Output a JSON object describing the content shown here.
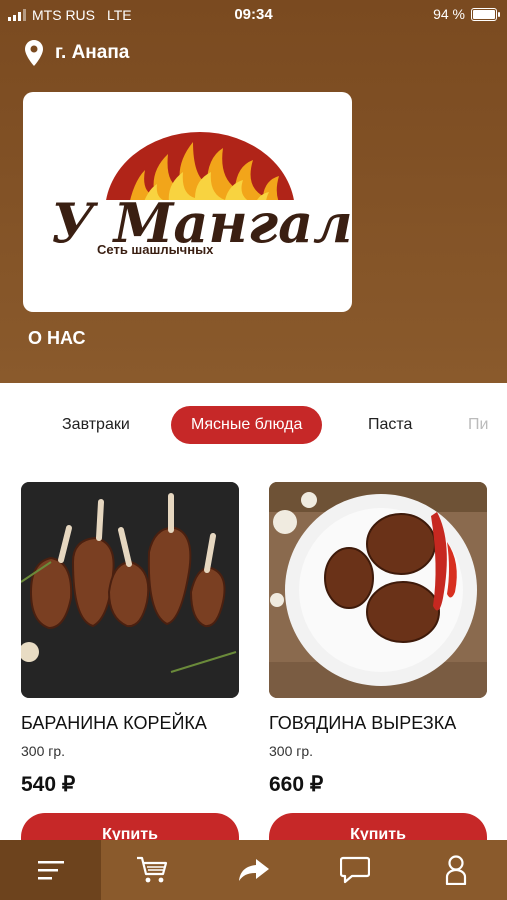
{
  "status_bar": {
    "carrier": "MTS RUS",
    "network": "LTE",
    "time": "09:34",
    "battery": "94 %"
  },
  "location": {
    "city": "г. Анапа",
    "icon": "location-pin-icon"
  },
  "brand": {
    "logo_text": "У Мангала",
    "tagline": "Сеть шашлычных"
  },
  "about_label": "О НАС",
  "categories": [
    {
      "label": "Завтраки",
      "active": false
    },
    {
      "label": "Мясные блюда",
      "active": true
    },
    {
      "label": "Паста",
      "active": false
    },
    {
      "label": "Пи",
      "active": false
    }
  ],
  "products": [
    {
      "name": "БАРАНИНА КОРЕЙКА",
      "weight": "300 гр.",
      "price": "540 ₽",
      "button": "Купить"
    },
    {
      "name": "ГОВЯДИНА ВЫРЕЗКА",
      "weight": "300 гр.",
      "price": "660 ₽",
      "button": "Купить"
    }
  ],
  "bottom_nav": [
    {
      "icon": "menu-icon",
      "active": true
    },
    {
      "icon": "cart-icon",
      "active": false
    },
    {
      "icon": "share-icon",
      "active": false
    },
    {
      "icon": "chat-icon",
      "active": false
    },
    {
      "icon": "profile-icon",
      "active": false
    }
  ],
  "colors": {
    "header_brown": "#7a4a20",
    "accent_red": "#c62828",
    "nav_brown": "#8a5a2c"
  }
}
